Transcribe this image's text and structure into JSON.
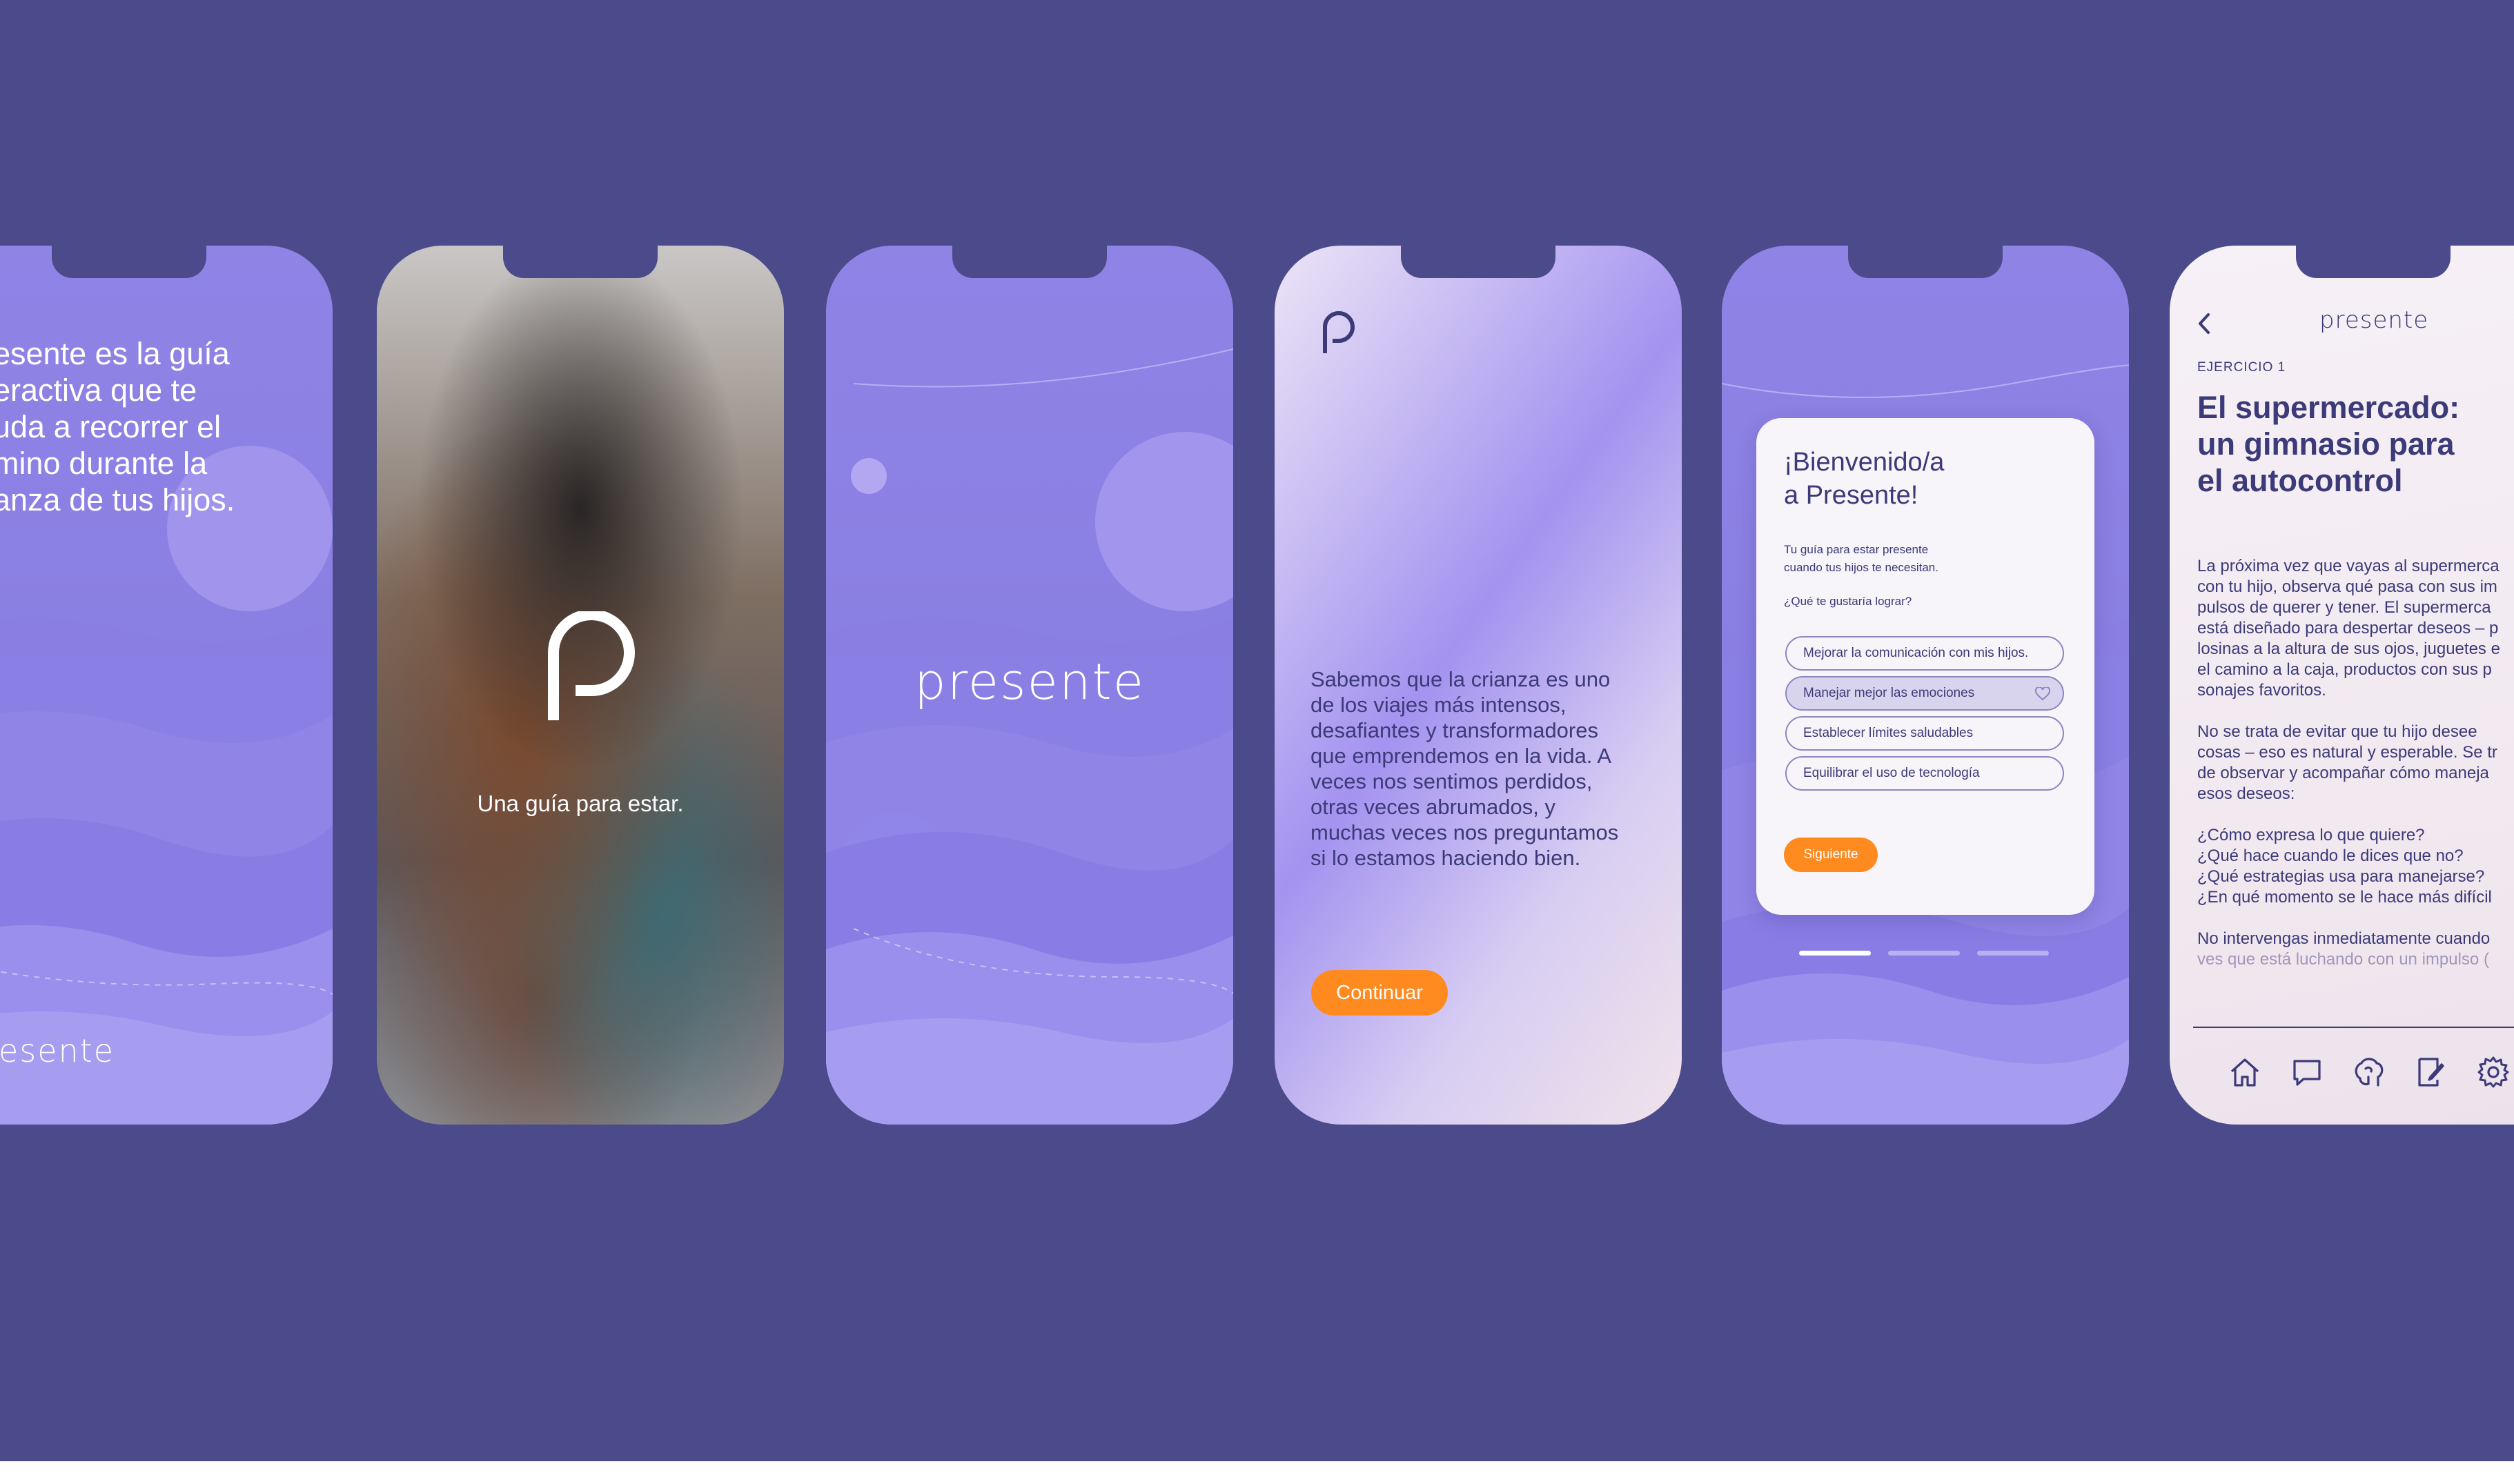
{
  "screen1": {
    "headline_lines": [
      "esente es la guía",
      "eractiva que te",
      "uda a recorrer el",
      "mino durante la",
      "anza de tus hijos."
    ],
    "footer_word": "esente"
  },
  "screen2": {
    "tagline": "Una guía para estar."
  },
  "screen3": {
    "wordmark": "presente"
  },
  "screen4": {
    "body_lines": [
      "Sabemos que la crianza es uno",
      "de los viajes más intensos,",
      "desafiantes y transformadores",
      "que emprendemos en la vida. A",
      "veces nos sentimos perdidos,",
      "otras veces abrumados, y",
      "muchas veces nos preguntamos",
      "si lo estamos haciendo bien."
    ],
    "continue_label": "Continuar"
  },
  "screen5": {
    "title_lines": [
      "¡Bienvenido/a",
      "a Presente!"
    ],
    "subtitle_lines": [
      "Tu guía para estar presente",
      "cuando tus hijos te necesitan."
    ],
    "question": "¿Qué te gustaría lograr?",
    "options": [
      {
        "label": "Mejorar la comunicación con mis hijos."
      },
      {
        "label": "Manejar mejor las emociones"
      },
      {
        "label": "Establecer límites saludables"
      },
      {
        "label": "Equilibrar el uso de tecnología"
      }
    ],
    "selected_index": 1,
    "next_label": "Siguiente",
    "pagination": {
      "pages": 3,
      "current": 1
    }
  },
  "screen6": {
    "app_title": "presente",
    "kicker": "EJERCICIO 1",
    "title_lines": [
      "El supermercado:",
      "un gimnasio para",
      "el autocontrol"
    ],
    "para1_lines": [
      "La próxima vez que vayas al supermerca",
      "con tu hijo, observa qué pasa con sus im",
      "pulsos de querer y tener. El supermerca",
      "está diseñado para despertar deseos – p",
      "losinas a la altura de sus ojos, juguetes e",
      "el camino a la caja, productos con sus p",
      "sonajes favoritos."
    ],
    "para2_lines": [
      "No se trata de evitar que tu hijo desee",
      "cosas – eso es natural y esperable. Se tr",
      "de observar y acompañar cómo maneja",
      "esos deseos:"
    ],
    "questions_lines": [
      "¿Cómo expresa lo que quiere?",
      "¿Qué hace cuando le dices que no?",
      "¿Qué estrategias usa para manejarse?",
      "¿En qué momento se le hace más difícil"
    ],
    "para3_lines": [
      "No intervengas inmediatamente cuando",
      "ves que está luchando con un impulso ("
    ],
    "nav_icons": [
      "home-icon",
      "chat-icon",
      "brain-icon",
      "journal-icon",
      "settings-icon"
    ]
  },
  "colors": {
    "board": "#4b4a8a",
    "accent": "#ff8a1f",
    "ink": "#3c3a78",
    "lavender": "#8f83e6"
  }
}
